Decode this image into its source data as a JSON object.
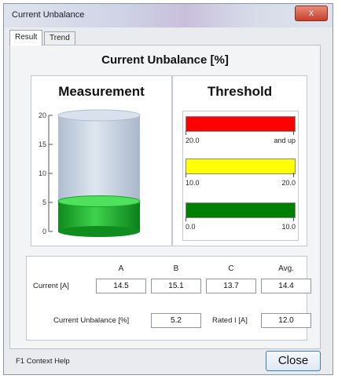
{
  "window": {
    "title": "Current Unbalance",
    "close_glyph": "x"
  },
  "tabs": [
    {
      "label": "Result",
      "active": true
    },
    {
      "label": "Trend",
      "active": false
    }
  ],
  "panel_title": "Current Unbalance [%]",
  "measurement": {
    "heading": "Measurement",
    "scale_ticks": [
      "20",
      "15",
      "10",
      "5",
      "0"
    ],
    "scale_max": 20,
    "level": 5.2,
    "fill_color": "#1ca42c",
    "glass_color": "#c9d5e3"
  },
  "threshold": {
    "heading": "Threshold",
    "bands": [
      {
        "color": "#ff0000",
        "low": "20.0",
        "high": "and up"
      },
      {
        "color": "#ffff00",
        "low": "10.0",
        "high": "20.0"
      },
      {
        "color": "#008000",
        "low": "0.0",
        "high": "10.0"
      }
    ]
  },
  "readings": {
    "columns": [
      "A",
      "B",
      "C",
      "Avg."
    ],
    "current_label": "Current [A]",
    "current_values": [
      "14.5",
      "15.1",
      "13.7",
      "14.4"
    ],
    "unbalance_label": "Current Unbalance [%]",
    "unbalance_value": "5.2",
    "rated_label": "Rated I [A]",
    "rated_value": "12.0"
  },
  "footer": {
    "help_text": "F1 Context Help",
    "close_label": "Close"
  }
}
